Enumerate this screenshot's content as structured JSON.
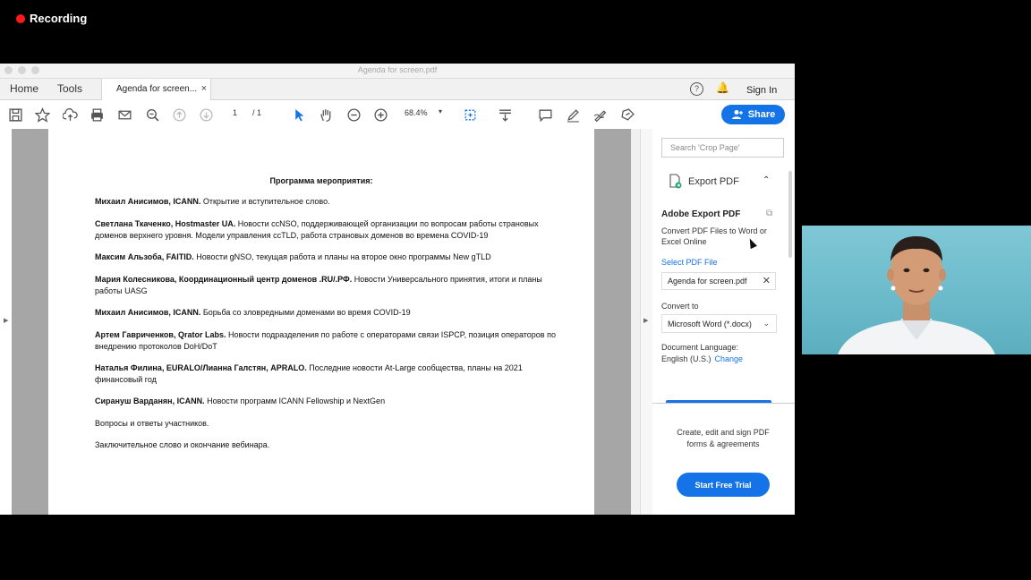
{
  "recording": {
    "label": "Recording"
  },
  "window": {
    "title": "Agenda for screen.pdf"
  },
  "nav": {
    "home": "Home",
    "tools": "Tools",
    "doc_tab": "Agenda for screen...",
    "close": "×",
    "help": "?",
    "signin": "Sign In"
  },
  "toolbar": {
    "page_current": "1",
    "page_total": "/ 1",
    "zoom": "68.4%",
    "share": "Share"
  },
  "document": {
    "title": "Программа мероприятия:",
    "items": [
      {
        "bold": "Михаил Анисимов, ICANN.",
        "text": " Открытие и вступительное слово."
      },
      {
        "bold": "Светлана Ткаченко, Hostmaster UA.",
        "text": " Новости ccNSO, поддерживающей организации по вопросам работы страновых доменов верхнего уровня. Модели управления ccTLD, работа страновых доменов во времена COVID-19"
      },
      {
        "bold": "Максим Альзоба, FAITID.",
        "text": " Новости gNSO, текущая работа и планы на второе окно программы New gTLD"
      },
      {
        "bold": "Мария Колесникова, Координационный центр доменов .RU/.РФ.",
        "text": " Новости Универсального принятия, итоги и планы работы UASG"
      },
      {
        "bold": "Михаил Анисимов, ICANN.",
        "text": " Борьба со зловредными доменами во время COVID-19"
      },
      {
        "bold": "Артем Гавриченков, Qrator Labs.",
        "text": " Новости подразделения по работе с операторами связи ISPCP, позиция операторов по внедрению протоколов DoH/DoT"
      },
      {
        "bold": "Наталья Филина, EURALO/Лианна Галстян, APRALO.",
        "text": " Последние новости At-Large сообщества, планы на 2021 финансовый год"
      },
      {
        "bold": "Сирануш Варданян, ICANN.",
        "text": " Новости программ ICANN Fellowship и NextGen"
      },
      {
        "bold": "",
        "text": "Вопросы и ответы участников."
      },
      {
        "bold": "",
        "text": "Заключительное слово и окончание вебинара."
      }
    ]
  },
  "right_panel": {
    "search_placeholder": "Search 'Crop Page'",
    "export_label": "Export PDF",
    "ae_title": "Adobe Export PDF",
    "ae_desc": "Convert PDF Files to Word or Excel Online",
    "select_link": "Select PDF File",
    "file_name": "Agenda for screen.pdf",
    "convert_label": "Convert to",
    "convert_value": "Microsoft Word (*.docx)",
    "lang_label": "Document Language:",
    "lang_value": "English (U.S.)",
    "lang_change": "Change",
    "promo_text": "Create, edit and sign PDF forms & agreements",
    "trial_button": "Start Free Trial"
  },
  "colors": {
    "accent": "#1473e6",
    "recording": "#ff1a1a"
  }
}
